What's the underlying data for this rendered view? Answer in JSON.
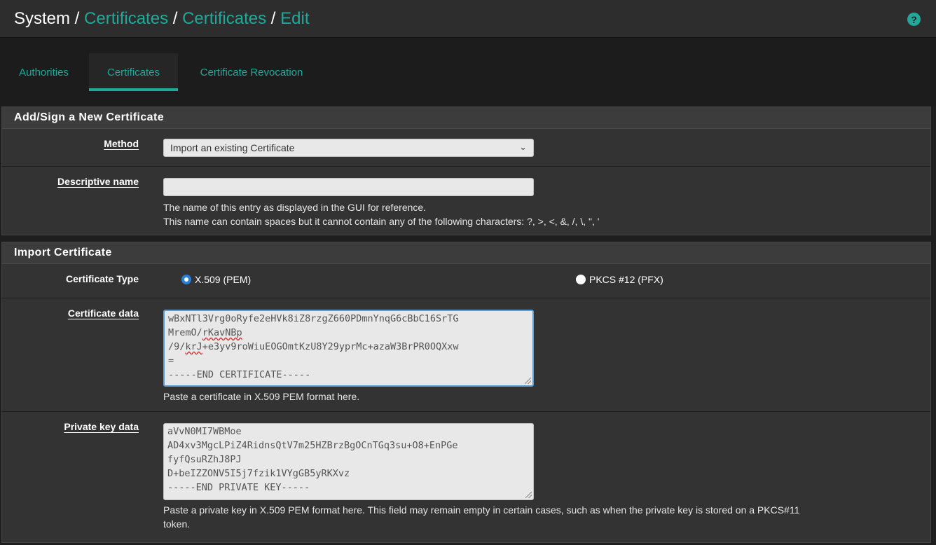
{
  "breadcrumb": {
    "system": "System",
    "sep1": " / ",
    "certificates1": "Certificates",
    "sep2": " / ",
    "certificates2": "Certificates",
    "sep3": " / ",
    "edit": "Edit"
  },
  "help_icon": {
    "icon": "question-circle-icon",
    "glyph": "?"
  },
  "tabs": [
    {
      "label": "Authorities"
    },
    {
      "label": "Certificates",
      "active": true
    },
    {
      "label": "Certificate Revocation"
    }
  ],
  "add_panel": {
    "heading": "Add/Sign a New Certificate",
    "method": {
      "label": "Method",
      "value": "Import an existing Certificate"
    },
    "descriptive_name": {
      "label": "Descriptive name",
      "value": "",
      "help1": "The name of this entry as displayed in the GUI for reference.",
      "help2": "This name can contain spaces but it cannot contain any of the following characters: ?, >, <, &, /, \\, \", '"
    }
  },
  "import_panel": {
    "heading": "Import Certificate",
    "cert_type": {
      "label": "Certificate Type",
      "option1": "X.509 (PEM)",
      "option2": "PKCS #12 (PFX)",
      "selected": "X.509 (PEM)"
    },
    "cert_data": {
      "label": "Certificate data",
      "lines": [
        "wBxNTl3Vrg0oRyfe2eHVk8iZ8rzgZ660PDmnYnqG6cBbC16SrTG",
        "MremO/",
        "rKavNBp",
        "/9/",
        "krJ",
        "+e3yv9roWiuEOGOmtKzU8Y29yprMc+azaW3BrPR0OQXxw",
        "=",
        "-----END CERTIFICATE-----"
      ],
      "help": "Paste a certificate in X.509 PEM format here."
    },
    "key_data": {
      "label": "Private key data",
      "lines": [
        "aVvN0MI7WBMoe",
        "AD4xv3MgcLPiZ4RidnsQtV7m25HZBrzBgOCnTGq3su+O8+EnPGe",
        "fyfQsuRZhJ8PJ",
        "D+beIZZONV5I5j7fzik1VYgGB5yRKXvz",
        "-----END PRIVATE KEY-----"
      ],
      "help1": "Paste a private key in X.509 PEM format here. This field may remain empty in certain cases, such as when the private key is stored on a PKCS#11",
      "help2": "token."
    }
  },
  "colors": {
    "accent": "#1fa99a",
    "panel_bg": "#333333",
    "page_bg": "#1e1e1e",
    "focus_border": "#5b9dd9"
  }
}
